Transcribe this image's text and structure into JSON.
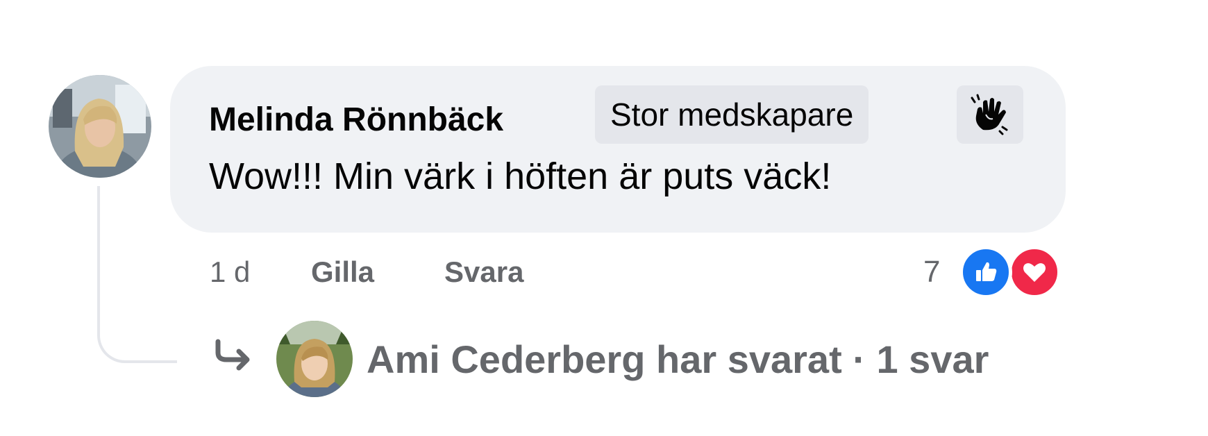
{
  "comment": {
    "author": "Melinda Rönnbäck",
    "badge_label": "Stor medskapare",
    "badge_icon": "waving-hand-icon",
    "text": "Wow!!! Min värk i höften är puts väck!",
    "time": "1 d",
    "like_label": "Gilla",
    "reply_label": "Svara",
    "reaction_count": "7",
    "reactions": [
      "like-icon",
      "love-icon"
    ]
  },
  "replies": {
    "summary": "Ami Cederberg har svarat · 1 svar",
    "arrow_icon": "reply-arrow-icon"
  },
  "colors": {
    "bubble": "#f0f2f5",
    "badge": "#e4e6eb",
    "meta_text": "#65676b",
    "like_blue": "#1877f2",
    "love_red": "#f02849"
  }
}
